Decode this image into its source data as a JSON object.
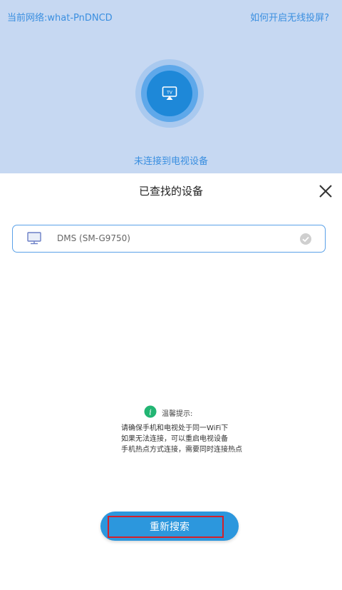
{
  "header": {
    "network_label": "当前网络:what-PnDNCD",
    "help_link": "如何开启无线投屏?"
  },
  "cast_status": {
    "icon": "tv-cast-icon",
    "text": "未连接到电视设备"
  },
  "sheet": {
    "title": "已查找的设备",
    "close_icon": "close-icon"
  },
  "devices": [
    {
      "name": "DMS  (SM-G9750)",
      "icon": "monitor-icon",
      "selected_icon": "check-circle-icon"
    }
  ],
  "tips": {
    "icon": "info-icon",
    "title": "温馨提示:",
    "lines": [
      "请确保手机和电视处于同一WiFi下",
      "如果无法连接，可以重启电视设备",
      "手机热点方式连接，需要同时连接热点"
    ]
  },
  "research_button": {
    "label": "重新搜索"
  },
  "colors": {
    "accent": "#2c97dd",
    "panel_bg": "#c6d8f2",
    "link_text": "#3b8fe0",
    "highlight_border": "#d4202a",
    "info_green": "#22b573"
  }
}
